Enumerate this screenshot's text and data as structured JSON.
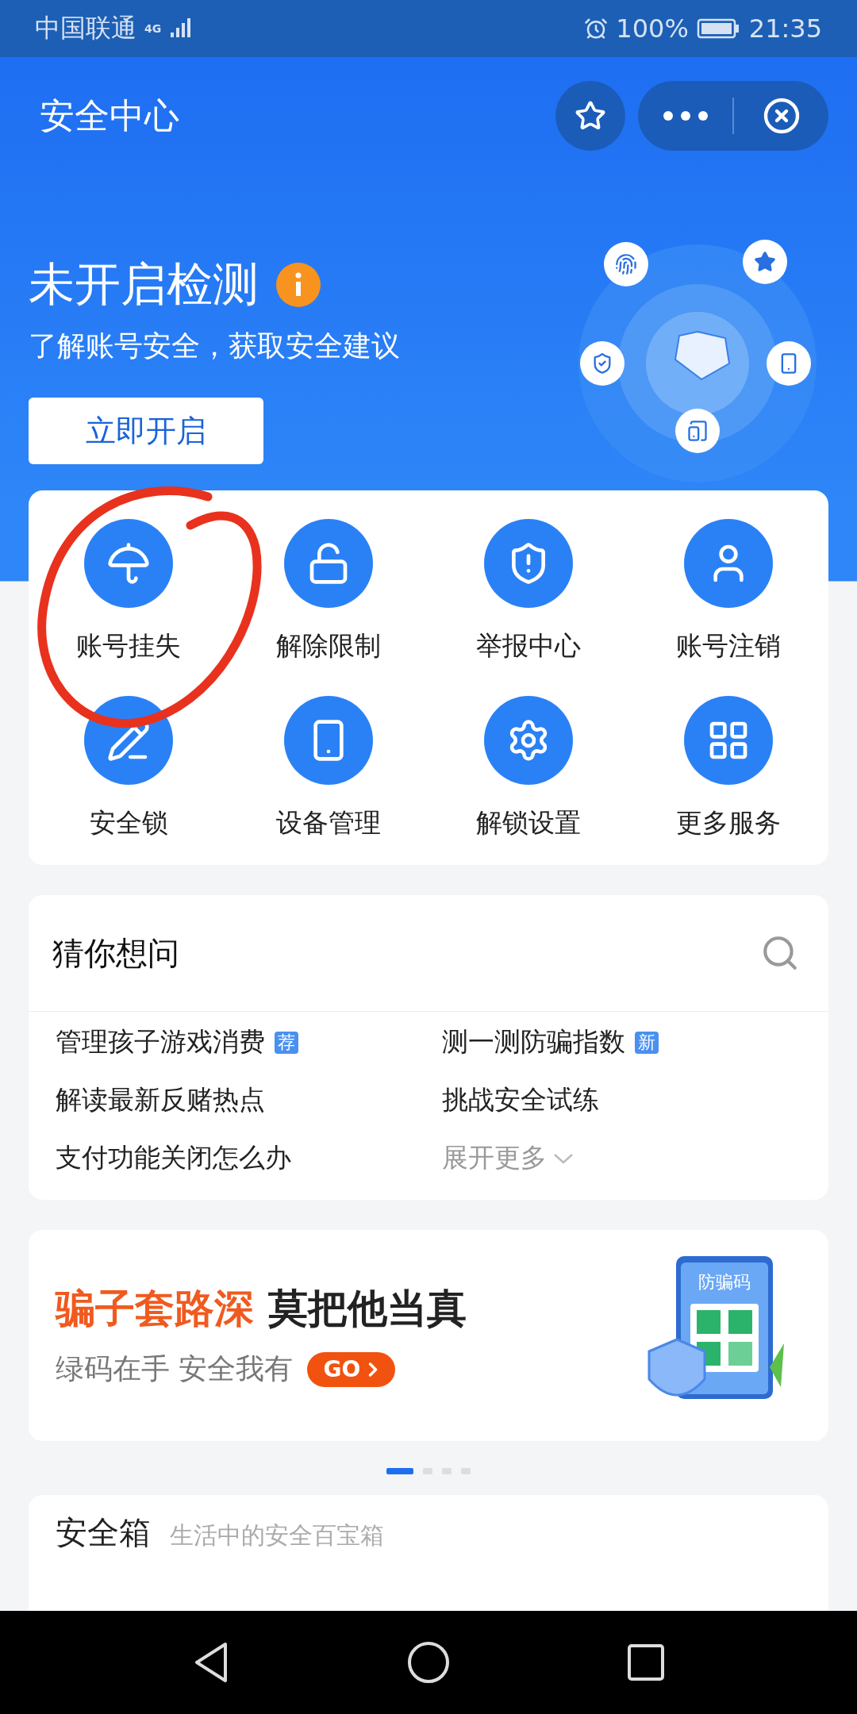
{
  "status_bar": {
    "carrier": "中国联通",
    "network": "4G",
    "battery": "100%",
    "time": "21:35"
  },
  "header": {
    "title": "安全中心"
  },
  "hero": {
    "title": "未开启检测",
    "subtitle": "了解账号安全，获取安全建议",
    "button": "立即开启"
  },
  "services": [
    {
      "label": "账号挂失"
    },
    {
      "label": "解除限制"
    },
    {
      "label": "举报中心"
    },
    {
      "label": "账号注销"
    },
    {
      "label": "安全锁"
    },
    {
      "label": "设备管理"
    },
    {
      "label": "解锁设置"
    },
    {
      "label": "更多服务"
    }
  ],
  "questions": {
    "title": "猜你想问",
    "items": [
      {
        "kind": "link",
        "text": "管理孩子游戏消费",
        "badge": "荐"
      },
      {
        "kind": "link",
        "text": "测一测防骗指数",
        "badge": "新"
      },
      {
        "kind": "link",
        "text": "解读最新反赌热点"
      },
      {
        "kind": "link",
        "text": "挑战安全试练"
      },
      {
        "kind": "link",
        "text": "支付功能关闭怎么办"
      },
      {
        "kind": "expand",
        "text": "展开更多"
      }
    ]
  },
  "banner": {
    "title_highlight": "骗子套路深",
    "title_rest": "莫把他当真",
    "subtitle": "绿码在手 安全我有",
    "button": "GO",
    "illustration_label": "防骗码"
  },
  "carousel": [
    {
      "selected": true
    },
    {
      "selected": false
    },
    {
      "selected": false
    },
    {
      "selected": false
    }
  ],
  "safe_box": {
    "title": "安全箱",
    "subtitle": "生活中的安全百宝箱"
  }
}
